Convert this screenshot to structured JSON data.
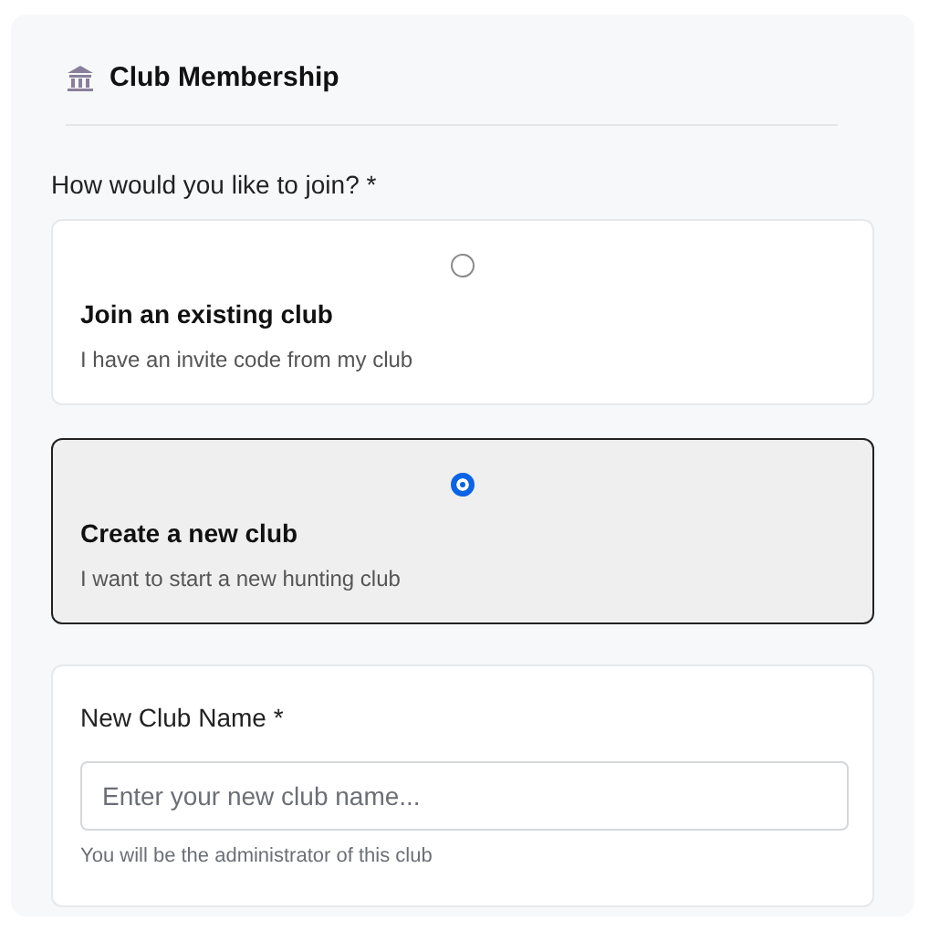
{
  "title": "Club Membership",
  "question": "How would you like to join? *",
  "options": [
    {
      "title": "Join an existing club",
      "description": "I have an invite code from my club",
      "selected": false
    },
    {
      "title": "Create a new club",
      "description": "I want to start a new hunting club",
      "selected": true
    }
  ],
  "club_name": {
    "label": "New Club Name *",
    "placeholder": "Enter your new club name...",
    "help": "You will be the administrator of this club"
  }
}
